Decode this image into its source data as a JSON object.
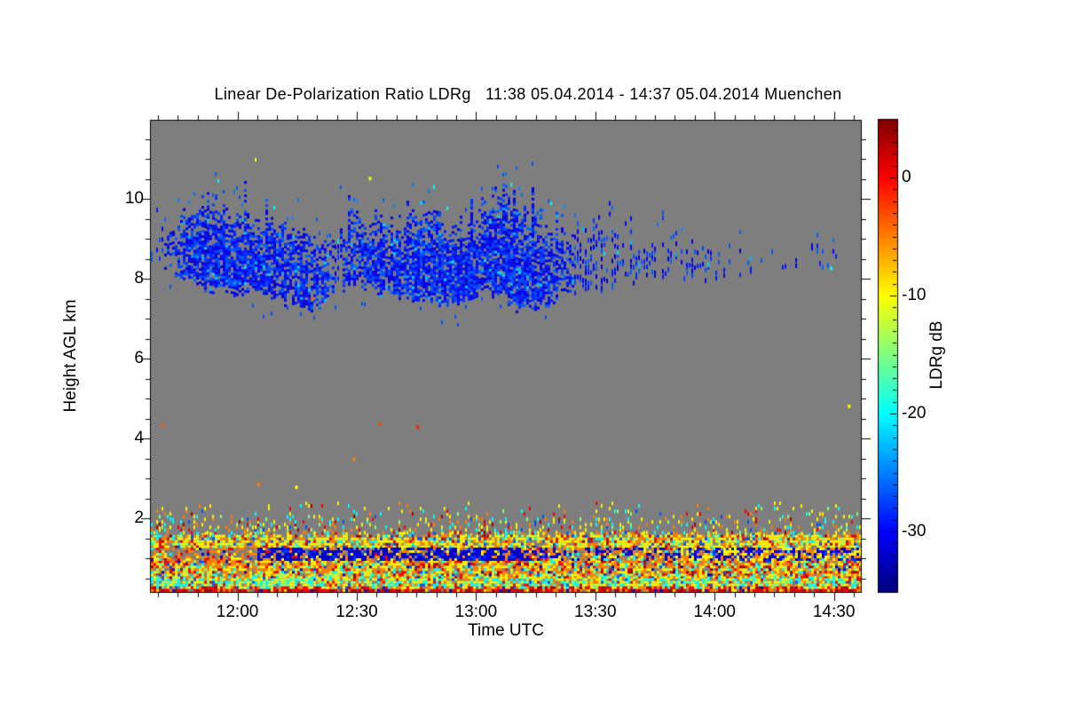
{
  "chart_data": {
    "type": "heatmap",
    "title": "Linear De-Polarization Ratio LDRg   11:38 05.04.2014 - 14:37 05.04.2014 Muenchen",
    "xlabel": "Time UTC",
    "ylabel": "Height AGL km",
    "x_start": "11:38",
    "x_end": "14:37",
    "duration_min": 179,
    "x_major_ticks": [
      {
        "minute": 22,
        "label": "12:00"
      },
      {
        "minute": 52,
        "label": "12:30"
      },
      {
        "minute": 82,
        "label": "13:00"
      },
      {
        "minute": 112,
        "label": "13:30"
      },
      {
        "minute": 142,
        "label": "14:00"
      },
      {
        "minute": 172,
        "label": "14:30"
      }
    ],
    "x_minor_step_min": 5,
    "y_major_ticks": [
      {
        "km": 2,
        "label": "2"
      },
      {
        "km": 4,
        "label": "4"
      },
      {
        "km": 6,
        "label": "6"
      },
      {
        "km": 8,
        "label": "8"
      },
      {
        "km": 10,
        "label": "10"
      }
    ],
    "y_minor_step_km": 0.5,
    "y_bottom_km": 0.13,
    "y_top_km": 11.98,
    "colorbar": {
      "label": "LDRg dB",
      "max_db": 4.9,
      "min_db": -35.1,
      "major_ticks": [
        {
          "db": 0,
          "label": "0"
        },
        {
          "db": -10,
          "label": "-10"
        },
        {
          "db": -20,
          "label": "-20"
        },
        {
          "db": -30,
          "label": "-30"
        }
      ],
      "minor_step_db": 1,
      "palette": "jet"
    },
    "no_signal_color": "#7e7e7e",
    "seed": 20140405,
    "cloud_ldr": {
      "mean_db": -29,
      "spread_db": 3,
      "cyan_fraction": 0.035
    },
    "cloud_keyframes": [
      [
        2,
        8.6,
        9.1,
        0.12
      ],
      [
        5,
        8.3,
        9.45,
        0.5
      ],
      [
        9,
        8.05,
        9.6,
        0.78
      ],
      [
        14,
        7.85,
        9.95,
        0.85
      ],
      [
        20,
        7.7,
        9.75,
        0.88
      ],
      [
        26,
        7.65,
        9.45,
        0.85
      ],
      [
        32,
        7.55,
        9.35,
        0.82
      ],
      [
        38,
        7.35,
        9.25,
        0.8
      ],
      [
        43,
        7.25,
        9.0,
        0.65
      ],
      [
        47,
        7.8,
        8.9,
        0.3
      ],
      [
        51,
        7.85,
        9.8,
        0.6
      ],
      [
        55,
        7.8,
        9.55,
        0.8
      ],
      [
        60,
        7.65,
        9.35,
        0.82
      ],
      [
        65,
        7.55,
        9.7,
        0.82
      ],
      [
        70,
        7.45,
        9.85,
        0.85
      ],
      [
        75,
        7.45,
        9.55,
        0.88
      ],
      [
        80,
        7.55,
        9.3,
        0.85
      ],
      [
        85,
        7.75,
        10.1,
        0.8
      ],
      [
        88,
        7.6,
        10.35,
        0.85
      ],
      [
        92,
        7.3,
        10.05,
        0.92
      ],
      [
        96,
        7.2,
        9.65,
        0.88
      ],
      [
        100,
        7.35,
        9.35,
        0.7
      ],
      [
        104,
        7.6,
        9.15,
        0.45
      ],
      [
        108,
        7.8,
        9.35,
        0.3
      ],
      [
        113,
        7.85,
        9.55,
        0.28
      ],
      [
        118,
        8.0,
        9.3,
        0.22
      ],
      [
        124,
        7.95,
        9.05,
        0.26
      ],
      [
        130,
        8.0,
        8.95,
        0.22
      ],
      [
        136,
        8.05,
        8.9,
        0.17
      ],
      [
        142,
        8.1,
        8.85,
        0.12
      ],
      [
        150,
        8.15,
        8.8,
        0.1
      ],
      [
        158,
        8.2,
        8.75,
        0.07
      ],
      [
        166,
        8.25,
        8.7,
        0.06
      ],
      [
        171,
        8.25,
        8.65,
        0.1
      ],
      [
        175,
        8.3,
        8.6,
        0.04
      ],
      [
        179,
        8.3,
        8.6,
        0.02
      ]
    ],
    "boundary_bands": [
      {
        "name": "speckle-zone",
        "km": [
          1.62,
          2.45
        ],
        "coverage": [
          0.32,
          0.02
        ],
        "dash": true,
        "palette": [
          [
            -9.5,
            0.28
          ],
          [
            -5,
            0.2
          ],
          [
            -20,
            0.2
          ],
          [
            -14.5,
            0.1
          ],
          [
            0.5,
            0.12
          ],
          [
            -27,
            0.06
          ],
          [
            3.5,
            0.04
          ]
        ]
      },
      {
        "name": "upper-dense",
        "km": [
          1.32,
          1.62
        ],
        "coverage": [
          0.93,
          0.93
        ],
        "dash": false,
        "palette": [
          [
            -9.5,
            0.42
          ],
          [
            -5,
            0.2
          ],
          [
            0.5,
            0.06
          ],
          [
            3.5,
            0.03
          ],
          [
            -20,
            0.08
          ],
          [
            -14.5,
            0.1
          ],
          [
            null,
            0.06
          ],
          [
            -27,
            0.05
          ]
        ]
      },
      {
        "name": "mid-dense",
        "km": [
          0.55,
          1.0
        ],
        "coverage": [
          0.96,
          0.96
        ],
        "dash": false,
        "palette": [
          [
            -5,
            0.3
          ],
          [
            -9.5,
            0.28
          ],
          [
            0.5,
            0.1
          ],
          [
            -14.5,
            0.08
          ],
          [
            -20,
            0.08
          ],
          [
            3.5,
            0.05
          ],
          [
            null,
            0.05
          ],
          [
            -27,
            0.03
          ],
          [
            -32,
            0.03
          ]
        ]
      },
      {
        "name": "low-cyan",
        "km": [
          0.3,
          0.55
        ],
        "coverage": [
          0.96,
          0.96
        ],
        "dash": false,
        "palette": [
          [
            -9.5,
            0.3
          ],
          [
            -14.5,
            0.2
          ],
          [
            -20,
            0.24
          ],
          [
            -5,
            0.12
          ],
          [
            0.5,
            0.05
          ],
          [
            null,
            0.06
          ],
          [
            -27,
            0.03
          ]
        ]
      },
      {
        "name": "ground-return",
        "km": [
          0.16,
          0.3
        ],
        "coverage": [
          0.98,
          0.98
        ],
        "dash": false,
        "palette": [
          [
            0.5,
            0.34
          ],
          [
            3.5,
            0.27
          ],
          [
            -5,
            0.18
          ],
          [
            -9.5,
            0.07
          ],
          [
            -32,
            0.08
          ],
          [
            null,
            0.06
          ]
        ]
      }
    ],
    "blue_layer": {
      "km": [
        1.0,
        1.32
      ],
      "segments": [
        {
          "t": [
            0,
            27
          ],
          "coverage": 0.9,
          "palette": [
            [
              null,
              0.42
            ],
            [
              -5,
              0.28
            ],
            [
              0.5,
              0.1
            ],
            [
              -9.5,
              0.14
            ],
            [
              -32,
              0.03
            ],
            [
              -20,
              0.03
            ]
          ]
        },
        {
          "t": [
            27,
            100
          ],
          "coverage": 0.97,
          "palette": [
            [
              -32,
              0.58
            ],
            [
              -28,
              0.12
            ],
            [
              -5,
              0.12
            ],
            [
              -9.5,
              0.08
            ],
            [
              null,
              0.06
            ],
            [
              0.5,
              0.04
            ]
          ]
        },
        {
          "t": [
            100,
            135
          ],
          "coverage": 0.95,
          "palette": [
            [
              null,
              0.28
            ],
            [
              -32,
              0.26
            ],
            [
              -5,
              0.24
            ],
            [
              -9.5,
              0.14
            ],
            [
              -20,
              0.04
            ],
            [
              0.5,
              0.04
            ]
          ]
        },
        {
          "t": [
            135,
            179
          ],
          "coverage": 0.95,
          "palette": [
            [
              -32,
              0.3
            ],
            [
              -28,
              0.1
            ],
            [
              -5,
              0.2
            ],
            [
              -9.5,
              0.26
            ],
            [
              null,
              0.08
            ],
            [
              -20,
              0.06
            ]
          ]
        }
      ]
    },
    "sparse_specks": {
      "rate": 0.004,
      "km_min": 2.6,
      "km_max": 11.6,
      "palette": [
        [
          -21,
          0.35
        ],
        [
          -10,
          0.3
        ],
        [
          -5,
          0.2
        ],
        [
          -14,
          0.15
        ]
      ]
    },
    "isolated_dots": [
      [
        3,
        4.37,
        -4
      ],
      [
        57.5,
        4.4,
        -3
      ],
      [
        67,
        4.33,
        -1
      ],
      [
        51,
        3.52,
        -5
      ],
      [
        27,
        2.9,
        -5
      ],
      [
        36.5,
        2.82,
        -10
      ],
      [
        55,
        10.55,
        -11
      ],
      [
        40.5,
        7.55,
        -4
      ],
      [
        175.5,
        4.85,
        -10
      ],
      [
        171,
        8.3,
        -20
      ]
    ]
  }
}
